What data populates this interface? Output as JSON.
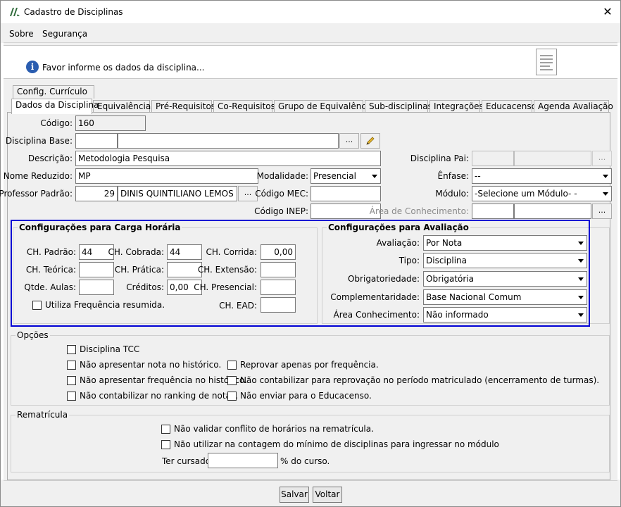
{
  "window": {
    "title": "Cadastro de Disciplinas",
    "close_glyph": "✕"
  },
  "menu": {
    "sobre": "Sobre",
    "seguranca": "Segurança"
  },
  "header": {
    "info": "Favor informe os dados da disciplina..."
  },
  "tabs": {
    "row1": [
      "Config. Currículo"
    ],
    "row2": [
      "Dados da Disciplina",
      "Equivalências",
      "Pré-Requisitos",
      "Co-Requisitos",
      "Grupo de Equivalência",
      "Sub-disciplinas",
      "Integrações",
      "Educacenso",
      "Agenda Avaliação"
    ]
  },
  "form": {
    "codigo_label": "Código:",
    "codigo_value": "160",
    "disciplina_base_label": "Disciplina Base:",
    "disciplina_base_code": "",
    "disciplina_base_name": "",
    "descricao_label": "Descrição:",
    "descricao_value": "Metodologia Pesquisa",
    "nome_reduzido_label": "Nome Reduzido:",
    "nome_reduzido_value": "MP",
    "modalidade_label": "Modalidade:",
    "modalidade_value": "Presencial",
    "professor_label": "Professor Padrão:",
    "professor_code": "29",
    "professor_name": "DINIS QUINTILIANO LEMOS",
    "codigo_mec_label": "Código MEC:",
    "codigo_mec_value": "",
    "codigo_inep_label": "Código INEP:",
    "codigo_inep_value": "",
    "disciplina_pai_label": "Disciplina Pai:",
    "enfase_label": "Ênfase:",
    "enfase_value": "--",
    "modulo_label": "Módulo:",
    "modulo_value": "-Selecione um Módulo- -",
    "area_conhecimento_label": "Área de Conhecimento:",
    "ellipsis": "..."
  },
  "carga": {
    "title": "Configurações para Carga Horária",
    "ch_padrao_label": "CH. Padrão:",
    "ch_padrao": "44",
    "ch_cobrada_label": "CH. Cobrada:",
    "ch_cobrada": "44",
    "ch_corrida_label": "CH. Corrida:",
    "ch_corrida": "0,00",
    "ch_teorica_label": "CH. Teórica:",
    "ch_teorica": "",
    "ch_pratica_label": "CH. Prática:",
    "ch_pratica": "",
    "ch_extensao_label": "CH. Extensão:",
    "ch_extensao": "",
    "qtde_aulas_label": "Qtde. Aulas:",
    "qtde_aulas": "",
    "creditos_label": "Créditos:",
    "creditos": "0,00",
    "ch_presencial_label": "CH. Presencial:",
    "ch_presencial": "",
    "ch_ead_label": "CH. EAD:",
    "ch_ead": "",
    "frequencia_resumida": "Utiliza Frequência resumida."
  },
  "avaliacao": {
    "title": "Configurações para Avaliação",
    "avaliacao_label": "Avaliação:",
    "avaliacao_value": "Por Nota",
    "tipo_label": "Tipo:",
    "tipo_value": "Disciplina",
    "obrigatoriedade_label": "Obrigatoriedade:",
    "obrigatoriedade_value": "Obrigatória",
    "complementaridade_label": "Complementaridade:",
    "complementaridade_value": "Base Nacional Comum",
    "area_label": "Área Conhecimento:",
    "area_value": "Não informado"
  },
  "opcoes": {
    "title": "Opções",
    "tcc": "Disciplina TCC",
    "nao_nota": "Não apresentar nota no histórico.",
    "nao_frequencia": "Não apresentar frequência no histórico.",
    "nao_ranking": "Não contabilizar no ranking de notas.",
    "reprovar_frequencia": "Reprovar apenas por frequência.",
    "nao_reprovacao": "Não contabilizar para reprovação no período matriculado (encerramento de turmas).",
    "nao_educacenso": "Não enviar para o Educacenso."
  },
  "rematricula": {
    "title": "Rematrícula",
    "nao_validar": "Não validar conflito de horários na rematrícula.",
    "nao_utilizar": "Não utilizar na contagem do mínimo de disciplinas para ingressar no módulo",
    "ter_cursado_label": "Ter cursado:",
    "ter_cursado_value": "",
    "percent_label": "% do curso."
  },
  "buttons": {
    "salvar": "Salvar",
    "voltar": "Voltar"
  },
  "colors": {
    "highlight": "#0000d4",
    "info_icon": "#2a5db0"
  },
  "icons": {
    "app": "app-logo-icon",
    "info": "info-icon",
    "doc": "document-icon",
    "edit": "pencil-icon"
  }
}
